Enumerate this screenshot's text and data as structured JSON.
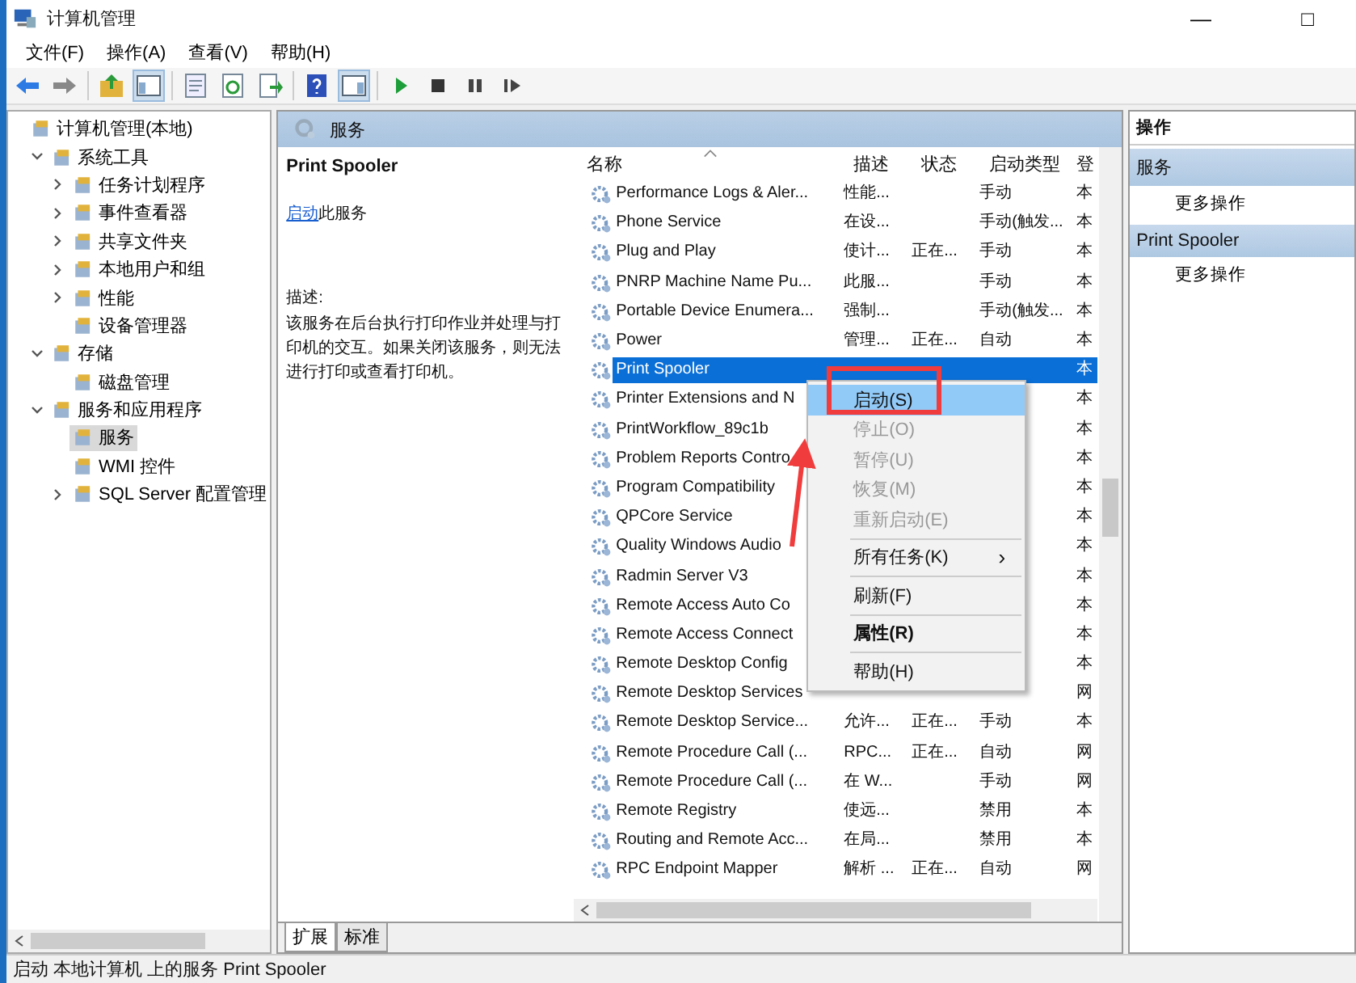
{
  "window": {
    "title": "计算机管理",
    "controls": [
      "—",
      "□"
    ]
  },
  "menu_bar": [
    "文件(F)",
    "操作(A)",
    "查看(V)",
    "帮助(H)"
  ],
  "tree": [
    {
      "label": "计算机管理(本地)",
      "selected": false,
      "children": [
        {
          "label": "系统工具",
          "expanded": true,
          "selected": false,
          "children": [
            {
              "label": "任务计划程序",
              "expanded": false,
              "selected": false
            },
            {
              "label": "事件查看器",
              "expanded": false,
              "selected": false
            },
            {
              "label": "共享文件夹",
              "expanded": false,
              "selected": false
            },
            {
              "label": "本地用户和组",
              "expanded": false,
              "selected": false
            },
            {
              "label": "性能",
              "expanded": false,
              "selected": false
            },
            {
              "label": "设备管理器",
              "selected": false
            }
          ]
        },
        {
          "label": "存储",
          "expanded": true,
          "selected": false,
          "children": [
            {
              "label": "磁盘管理",
              "selected": false
            }
          ]
        },
        {
          "label": "服务和应用程序",
          "expanded": true,
          "selected": false,
          "children": [
            {
              "label": "服务",
              "selected": true
            },
            {
              "label": "WMI 控件",
              "selected": false
            },
            {
              "label": "SQL Server 配置管理",
              "expanded": false,
              "selected": false
            }
          ]
        }
      ]
    }
  ],
  "center": {
    "header": "服务",
    "detail": {
      "title": "Print Spooler",
      "link": "启动",
      "link_rest": "此服务",
      "desc_label": "描述:",
      "description": "该服务在后台执行打印作业并处理与打印机的交互。如果关闭该服务，则无法进行打印或查看打印机。"
    },
    "table": {
      "columns": [
        "名称",
        "描述",
        "状态",
        "启动类型",
        "登"
      ],
      "rows": [
        {
          "name": "Performance Logs & Aler...",
          "desc": "性能...",
          "status": "",
          "startup": "手动",
          "column_5": "本",
          "selected": false
        },
        {
          "name": "Phone Service",
          "desc": "在设...",
          "status": "",
          "startup": "手动(触发...",
          "column_5": "本",
          "selected": false
        },
        {
          "name": "Plug and Play",
          "desc": "使计...",
          "status": "正在...",
          "startup": "手动",
          "column_5": "本",
          "selected": false
        },
        {
          "name": "PNRP Machine Name Pu...",
          "desc": "此服...",
          "status": "",
          "startup": "手动",
          "column_5": "本",
          "selected": false
        },
        {
          "name": "Portable Device Enumera...",
          "desc": "强制...",
          "status": "",
          "startup": "手动(触发...",
          "column_5": "本",
          "selected": false
        },
        {
          "name": "Power",
          "desc": "管理...",
          "status": "正在...",
          "startup": "自动",
          "column_5": "本",
          "selected": false
        },
        {
          "name": "Print Spooler",
          "desc": "",
          "status": "",
          "startup": "",
          "column_5": "本",
          "selected": true
        },
        {
          "name": "Printer Extensions and N",
          "desc": "",
          "status": "",
          "startup": "",
          "column_5": "本",
          "selected": false
        },
        {
          "name": "PrintWorkflow_89c1b",
          "desc": "",
          "status": "",
          "startup": "",
          "column_5": "本",
          "selected": false
        },
        {
          "name": "Problem Reports Contro",
          "desc": "",
          "status": "",
          "startup": "",
          "column_5": "本",
          "selected": false
        },
        {
          "name": "Program Compatibility",
          "desc": "",
          "status": "",
          "startup": "",
          "column_5": "本",
          "selected": false
        },
        {
          "name": "QPCore Service",
          "desc": "",
          "status": "",
          "startup": "",
          "column_5": "本",
          "selected": false
        },
        {
          "name": "Quality Windows Audio",
          "desc": "",
          "status": "",
          "startup": "",
          "column_5": "本",
          "selected": false
        },
        {
          "name": "Radmin Server V3",
          "desc": "",
          "status": "",
          "startup": "",
          "column_5": "本",
          "selected": false
        },
        {
          "name": "Remote Access Auto Co",
          "desc": "",
          "status": "",
          "startup": "",
          "column_5": "本",
          "selected": false
        },
        {
          "name": "Remote Access Connect",
          "desc": "",
          "status": "",
          "startup": "",
          "column_5": "本",
          "selected": false
        },
        {
          "name": "Remote Desktop Config",
          "desc": "",
          "status": "",
          "startup": "",
          "column_5": "本",
          "selected": false
        },
        {
          "name": "Remote Desktop Services",
          "desc": "",
          "status": "",
          "startup": "",
          "column_5": "网",
          "selected": false
        },
        {
          "name": "Remote Desktop Service...",
          "desc": "允许...",
          "status": "正在...",
          "startup": "手动",
          "column_5": "本",
          "selected": false
        },
        {
          "name": "Remote Procedure Call (...",
          "desc": "RPC...",
          "status": "正在...",
          "startup": "自动",
          "column_5": "网",
          "selected": false
        },
        {
          "name": "Remote Procedure Call (...",
          "desc": "在 W...",
          "status": "",
          "startup": "手动",
          "column_5": "网",
          "selected": false
        },
        {
          "name": "Remote Registry",
          "desc": "使远...",
          "status": "",
          "startup": "禁用",
          "column_5": "本",
          "selected": false
        },
        {
          "name": "Routing and Remote Acc...",
          "desc": "在局...",
          "status": "",
          "startup": "禁用",
          "column_5": "本",
          "selected": false
        },
        {
          "name": "RPC Endpoint Mapper",
          "desc": "解析 ...",
          "status": "正在...",
          "startup": "自动",
          "column_5": "网",
          "selected": false
        }
      ]
    },
    "tabs": [
      {
        "label": "扩展",
        "selected": true
      },
      {
        "label": "标准",
        "selected": false
      }
    ]
  },
  "context_menu": [
    {
      "kind": "item",
      "label": "启动(S)",
      "selected": true,
      "disabled": false
    },
    {
      "kind": "item",
      "label": "停止(O)",
      "selected": false,
      "disabled": true
    },
    {
      "kind": "item",
      "label": "暂停(U)",
      "selected": false,
      "disabled": true
    },
    {
      "kind": "item",
      "label": "恢复(M)",
      "selected": false,
      "disabled": true
    },
    {
      "kind": "item",
      "label": "重新启动(E)",
      "selected": false,
      "disabled": true
    },
    {
      "kind": "separator"
    },
    {
      "kind": "submenu",
      "label": "所有任务(K)",
      "arrow": "›",
      "selected": false,
      "disabled": false
    },
    {
      "kind": "separator"
    },
    {
      "kind": "item",
      "label": "刷新(F)",
      "selected": false,
      "disabled": false
    },
    {
      "kind": "separator"
    },
    {
      "kind": "bold",
      "label": "属性(R)",
      "selected": false,
      "disabled": false
    },
    {
      "kind": "separator"
    },
    {
      "kind": "item",
      "label": "帮助(H)",
      "selected": false,
      "disabled": false
    }
  ],
  "actions": {
    "title": "操作",
    "sections": [
      {
        "title": "服务",
        "items": [
          "更多操作"
        ]
      },
      {
        "title": "Print Spooler",
        "items": [
          "更多操作"
        ]
      }
    ]
  },
  "status_bar": "启动 本地计算机 上的服务 Print Spooler"
}
